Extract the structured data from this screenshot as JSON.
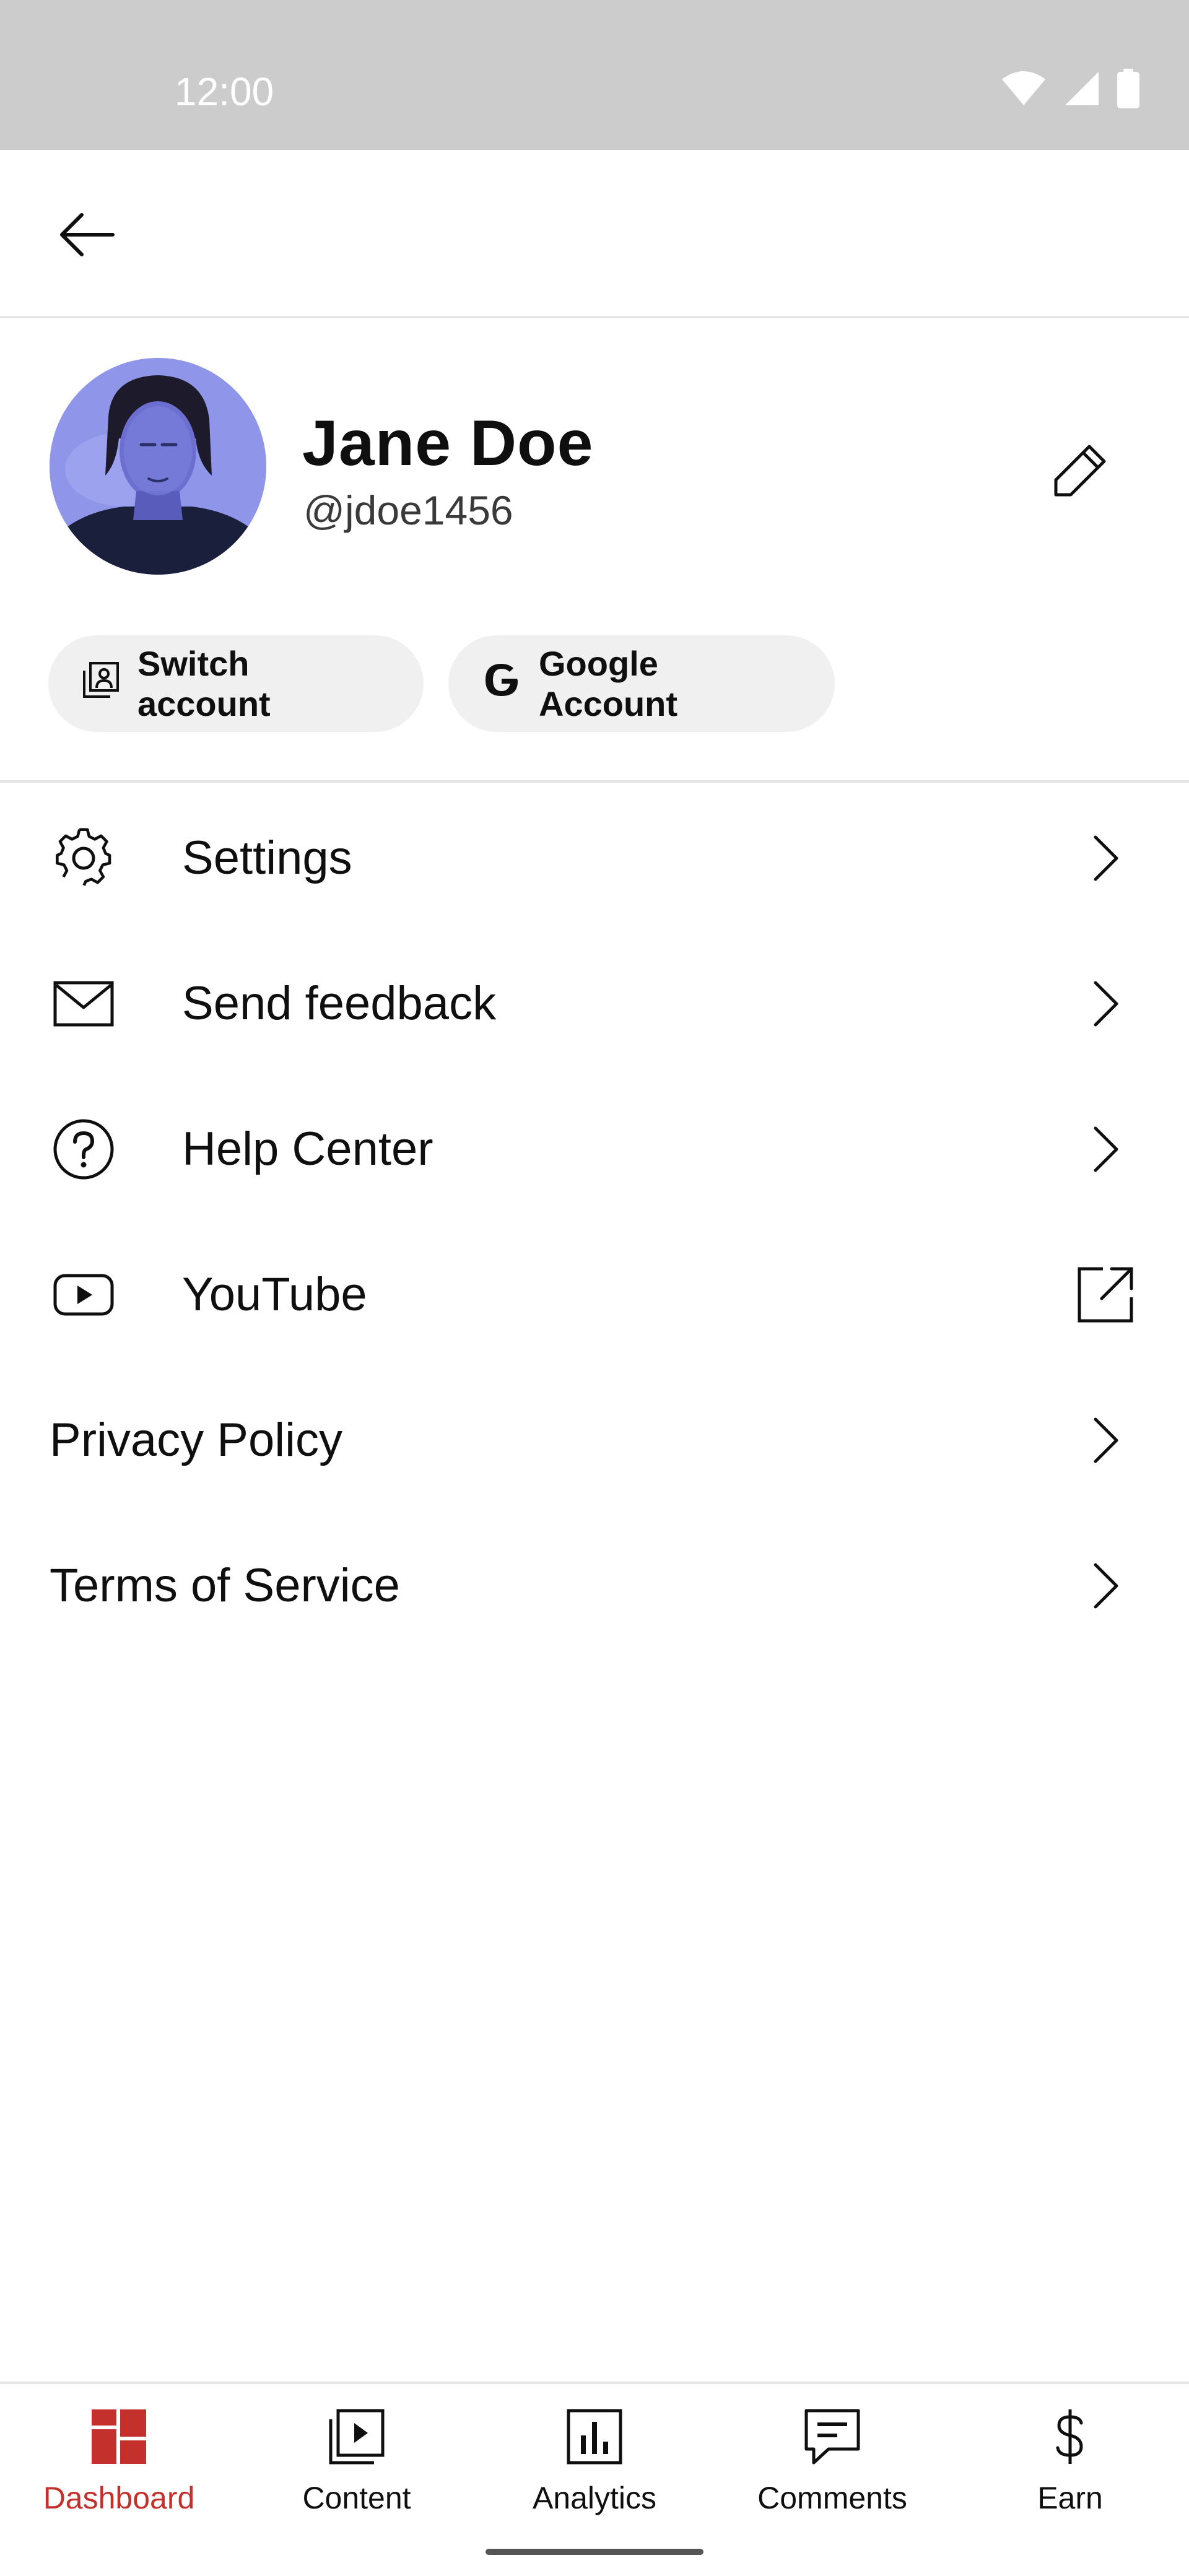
{
  "status_bar": {
    "time": "12:00",
    "icons": [
      "wifi-icon",
      "cell-signal-icon",
      "battery-icon"
    ],
    "background": "#cccccc"
  },
  "top_bar": {
    "back_icon": "arrow-back-icon"
  },
  "profile": {
    "name": "Jane Doe",
    "handle": "@jdoe1456",
    "edit_icon": "pencil-icon",
    "buttons": [
      {
        "label": "Switch account",
        "icon": "switch-account-icon"
      },
      {
        "label": "Google Account",
        "icon": "google-g-icon"
      }
    ]
  },
  "menu": {
    "items": [
      {
        "label": "Settings",
        "icon": "gear-icon",
        "trailing": "chevron-right-icon"
      },
      {
        "label": "Send feedback",
        "icon": "mail-icon",
        "trailing": "chevron-right-icon"
      },
      {
        "label": "Help Center",
        "icon": "help-circle-icon",
        "trailing": "chevron-right-icon"
      },
      {
        "label": "YouTube",
        "icon": "youtube-icon",
        "trailing": "open-external-icon"
      },
      {
        "label": "Privacy Policy",
        "icon": "",
        "trailing": "chevron-right-icon"
      },
      {
        "label": "Terms of Service",
        "icon": "",
        "trailing": "chevron-right-icon"
      }
    ]
  },
  "bottom_nav": {
    "active": "Dashboard",
    "active_color": "#c4302b",
    "items": [
      {
        "label": "Dashboard",
        "icon": "dashboard-icon"
      },
      {
        "label": "Content",
        "icon": "content-icon"
      },
      {
        "label": "Analytics",
        "icon": "analytics-icon"
      },
      {
        "label": "Comments",
        "icon": "comments-icon"
      },
      {
        "label": "Earn",
        "icon": "dollar-icon"
      }
    ]
  }
}
